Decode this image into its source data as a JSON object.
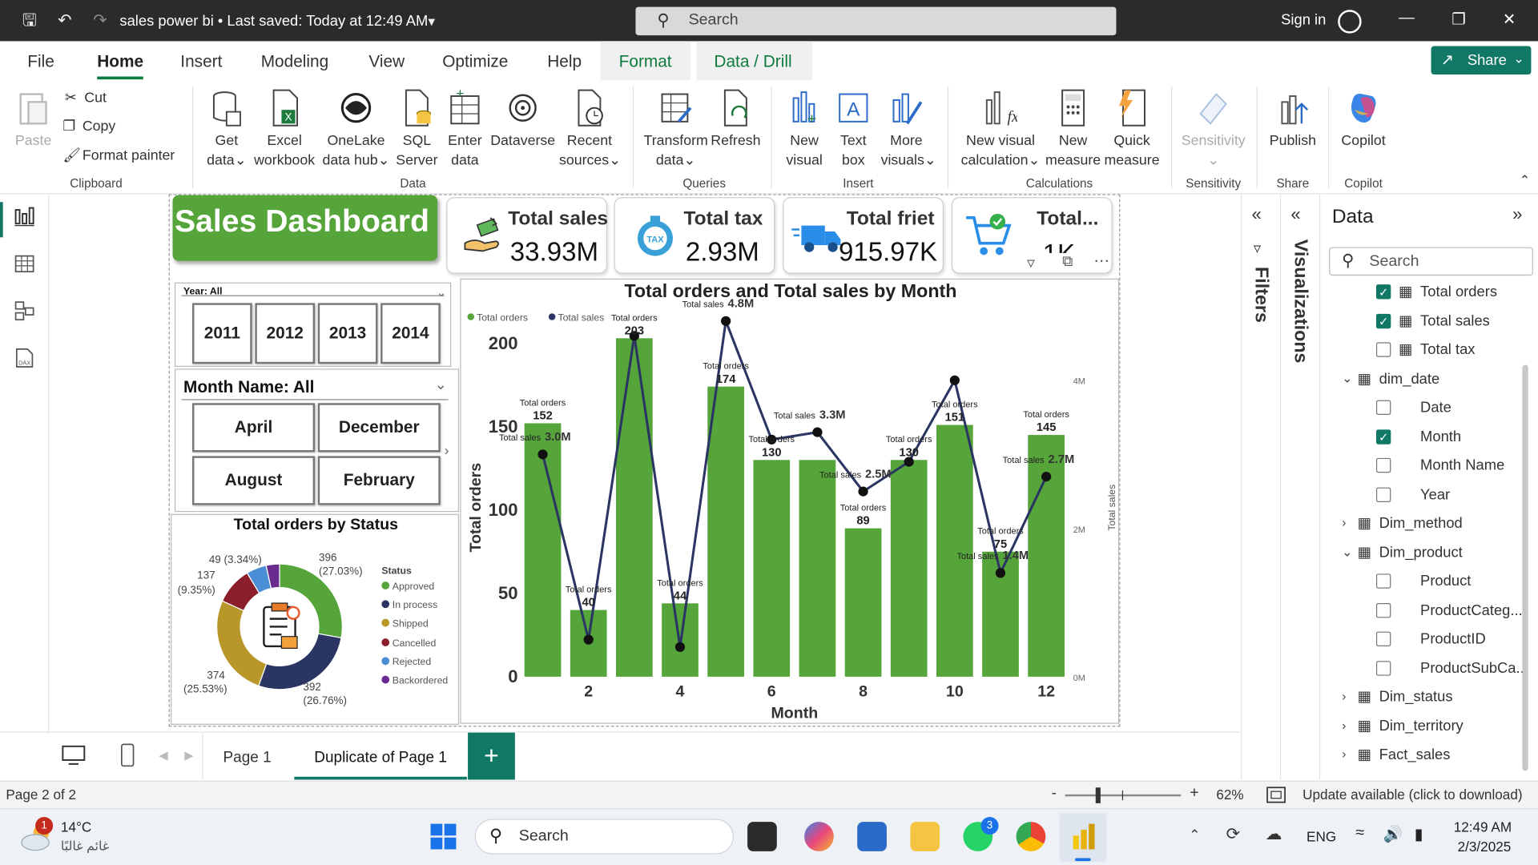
{
  "titlebar": {
    "doc_title": "sales power bi • Last saved: Today at 12:49 AM",
    "search_placeholder": "Search",
    "signin": "Sign in"
  },
  "menu": {
    "tabs": [
      "File",
      "Home",
      "Insert",
      "Modeling",
      "View",
      "Optimize",
      "Help",
      "Format",
      "Data / Drill"
    ],
    "active": "Home",
    "share": "Share"
  },
  "ribbon": {
    "clipboard": {
      "paste": "Paste",
      "cut": "Cut",
      "copy": "Copy",
      "format_painter": "Format painter",
      "group": "Clipboard"
    },
    "data": {
      "get_data": [
        "Get",
        "data"
      ],
      "excel": [
        "Excel",
        "workbook"
      ],
      "onelake": [
        "OneLake",
        "data hub"
      ],
      "sql": [
        "SQL",
        "Server"
      ],
      "enter": [
        "Enter",
        "data"
      ],
      "dataverse": "Dataverse",
      "recent": [
        "Recent",
        "sources"
      ],
      "group": "Data"
    },
    "queries": {
      "transform": [
        "Transform",
        "data"
      ],
      "refresh": "Refresh",
      "group": "Queries"
    },
    "insert": {
      "new_visual": [
        "New",
        "visual"
      ],
      "text_box": [
        "Text",
        "box"
      ],
      "more_visuals": [
        "More",
        "visuals"
      ],
      "group": "Insert"
    },
    "calculations": {
      "new_visual_calc": [
        "New visual",
        "calculation"
      ],
      "new_measure": [
        "New",
        "measure"
      ],
      "quick_measure": [
        "Quick",
        "measure"
      ],
      "group": "Calculations"
    },
    "sensitivity": {
      "label": "Sensitivity",
      "group": "Sensitivity"
    },
    "share": {
      "publish": "Publish",
      "group": "Share"
    },
    "copilot": {
      "label": "Copilot",
      "group": "Copilot"
    }
  },
  "report": {
    "title": "Sales Dashboard",
    "kpis": [
      {
        "label": "Total sales",
        "value": "33.93M"
      },
      {
        "label": "Total tax",
        "value": "2.93M"
      },
      {
        "label": "Total friet",
        "value": "915.97K"
      },
      {
        "label": "Total...",
        "value": "1K"
      }
    ],
    "year_slicer": {
      "header": "Year: All",
      "items": [
        "2011",
        "2012",
        "2013",
        "2014"
      ]
    },
    "month_slicer": {
      "header": "Month Name: All",
      "items": [
        "April",
        "December",
        "August",
        "February"
      ]
    },
    "donut": {
      "title": "Total orders by Status",
      "legend_title": "Status",
      "labels": [
        {
          "text": "396",
          "sub": "(27.03%)"
        },
        {
          "text": "392",
          "sub": "(26.76%)"
        },
        {
          "text": "374",
          "sub": "(25.53%)"
        },
        {
          "text": "137",
          "sub": "(9.35%)"
        },
        {
          "text": "49 (3.34%)",
          "sub": ""
        }
      ]
    }
  },
  "chart_data": [
    {
      "type": "bar+line",
      "title": "Total orders and Total sales by Month",
      "xlabel": "Month",
      "ylabel": "Total orders",
      "y2label": "Total sales",
      "legend": [
        "Total orders",
        "Total sales"
      ],
      "legend_position": "top-left",
      "categories": [
        1,
        2,
        3,
        4,
        5,
        6,
        7,
        8,
        9,
        10,
        11,
        12
      ],
      "x_ticks": [
        "2",
        "4",
        "6",
        "8",
        "10",
        "12"
      ],
      "y_ticks": [
        "0",
        "50",
        "100",
        "150",
        "200"
      ],
      "y2_ticks": [
        "0M",
        "2M",
        "4M"
      ],
      "ylim": [
        0,
        200
      ],
      "y2lim": [
        0,
        4.5
      ],
      "series": [
        {
          "name": "Total orders",
          "kind": "bar",
          "color": "#55a53a",
          "values": [
            152,
            40,
            203,
            44,
            174,
            130,
            130,
            89,
            130,
            151,
            75,
            145
          ],
          "labels": [
            "152",
            "40",
            "203",
            "44",
            "174",
            "130",
            "",
            "89",
            "130",
            "151",
            "75",
            "145"
          ]
        },
        {
          "name": "Total sales",
          "kind": "line",
          "color": "#2a3563",
          "values": [
            3.0,
            0.5,
            4.6,
            0.4,
            4.8,
            3.2,
            3.3,
            2.5,
            2.9,
            4.0,
            1.4,
            2.7
          ],
          "labels": [
            "3.0M",
            "",
            "",
            "",
            "4.8M",
            "",
            "3.3M",
            "2.5M",
            "",
            "",
            "1.4M",
            "2.7M"
          ]
        }
      ],
      "bar_label_prefix": "Total orders",
      "line_label_prefix": "Total sales"
    },
    {
      "type": "pie",
      "title": "Total orders by Status",
      "legend_title": "Status",
      "categories": [
        "Approved",
        "In process",
        "Shipped",
        "Cancelled",
        "Rejected",
        "Backordered"
      ],
      "values": [
        396,
        392,
        374,
        137,
        74,
        49
      ],
      "percent": [
        27.03,
        26.76,
        25.53,
        9.35,
        5.05,
        3.34
      ],
      "colors": [
        "#55a53a",
        "#2a3563",
        "#b8962a",
        "#8a1f2b",
        "#4a8fd6",
        "#6a2b8f"
      ]
    }
  ],
  "panes": {
    "filters": "Filters",
    "visualizations": "Visualizations",
    "data_title": "Data",
    "data_search": "Search"
  },
  "data_fields": [
    {
      "name": "Total orders",
      "checked": true,
      "kind": "measure"
    },
    {
      "name": "Total sales",
      "checked": true,
      "kind": "measure"
    },
    {
      "name": "Total tax",
      "checked": false,
      "kind": "measure"
    },
    {
      "name": "dim_date",
      "kind": "table",
      "expanded": true
    },
    {
      "name": "Date",
      "checked": false,
      "kind": "field"
    },
    {
      "name": "Month",
      "checked": true,
      "kind": "field"
    },
    {
      "name": "Month Name",
      "checked": false,
      "kind": "field"
    },
    {
      "name": "Year",
      "checked": false,
      "kind": "field"
    },
    {
      "name": "Dim_method",
      "kind": "table",
      "expanded": false
    },
    {
      "name": "Dim_product",
      "kind": "table",
      "expanded": true
    },
    {
      "name": "Product",
      "checked": false,
      "kind": "field"
    },
    {
      "name": "ProductCateg...",
      "checked": false,
      "kind": "field"
    },
    {
      "name": "ProductID",
      "checked": false,
      "kind": "field"
    },
    {
      "name": "ProductSubCa...",
      "checked": false,
      "kind": "field"
    },
    {
      "name": "Dim_status",
      "kind": "table",
      "expanded": false
    },
    {
      "name": "Dim_territory",
      "kind": "table",
      "expanded": false
    },
    {
      "name": "Fact_sales",
      "kind": "table",
      "expanded": false
    }
  ],
  "pages": {
    "tabs": [
      "Page 1",
      "Duplicate of Page 1"
    ],
    "active": "Duplicate of Page 1",
    "add": "+"
  },
  "statusbar": {
    "page": "Page 2 of 2",
    "zoom": "62%",
    "update": "Update available (click to download)"
  },
  "taskbar": {
    "weather_temp": "14°C",
    "weather_desc": "غائم غالبًا",
    "weather_badge": "1",
    "search": "Search",
    "lang": "ENG",
    "time": "12:49 AM",
    "date": "2/3/2025",
    "whatsapp_badge": "3"
  }
}
